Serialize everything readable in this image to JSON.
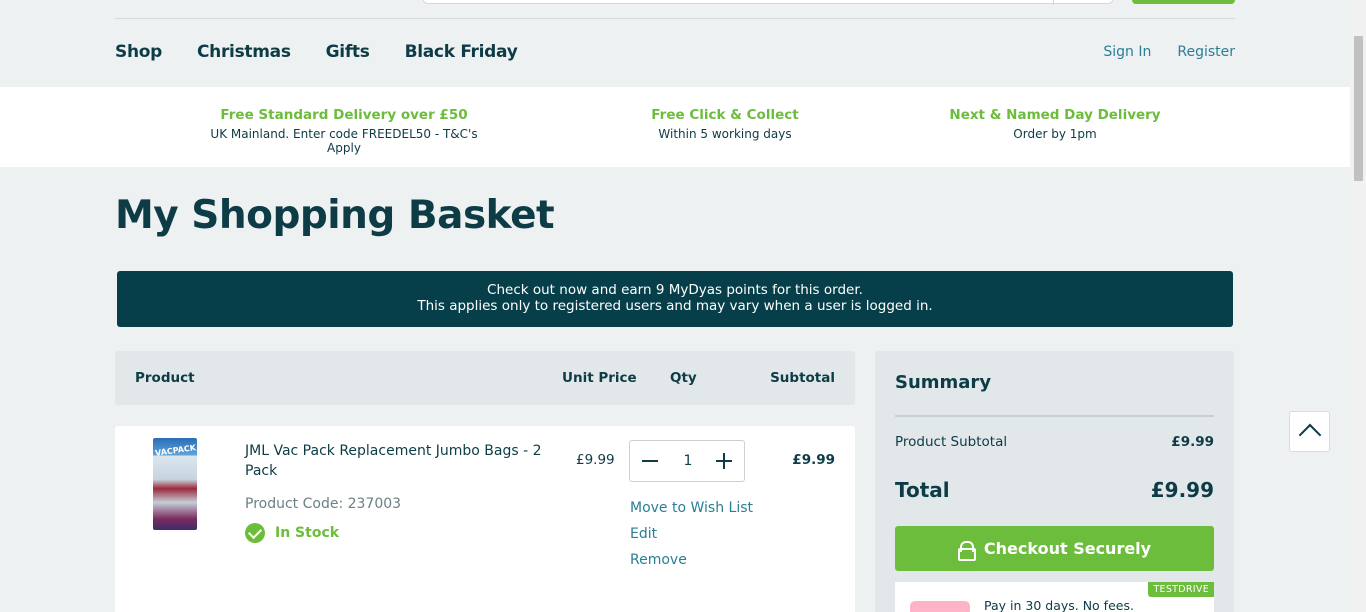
{
  "nav": {
    "items": [
      "Shop",
      "Christmas",
      "Gifts",
      "Black Friday"
    ],
    "sign_in": "Sign In",
    "register": "Register"
  },
  "benefits": [
    {
      "title": "Free Standard Delivery over £50",
      "sub": "UK Mainland. Enter code FREEDEL50 - T&C's Apply"
    },
    {
      "title": "Free Click & Collect",
      "sub": "Within 5 working days"
    },
    {
      "title": "Next & Named Day Delivery",
      "sub": "Order by 1pm"
    }
  ],
  "page_title": "My Shopping Basket",
  "points_banner": {
    "line1": "Check out now and earn 9 MyDyas points for this order.",
    "line2": "This applies only to registered users and may vary when a user is logged in."
  },
  "table": {
    "headers": {
      "product": "Product",
      "unit_price": "Unit Price",
      "qty": "Qty",
      "subtotal": "Subtotal"
    }
  },
  "item": {
    "name": "JML Vac Pack Replacement Jumbo Bags - 2 Pack",
    "code": "Product Code: 237003",
    "stock": "In Stock",
    "unit_price": "£9.99",
    "qty": "1",
    "subtotal": "£9.99",
    "move_to_wishlist": "Move to Wish List",
    "edit": "Edit",
    "remove": "Remove"
  },
  "summary": {
    "title": "Summary",
    "product_subtotal_label": "Product Subtotal",
    "product_subtotal_value": "£9.99",
    "total_label": "Total",
    "total_value": "£9.99",
    "checkout_label": "Checkout Securely",
    "klarna_text": "Pay in 30 days. No fees.",
    "klarna_badge": "TESTDRIVE"
  },
  "colors": {
    "brand_green": "#6cbd3b",
    "dark_teal": "#0d3b46",
    "banner_teal": "#063f4a",
    "link_blue": "#2a7f95"
  }
}
